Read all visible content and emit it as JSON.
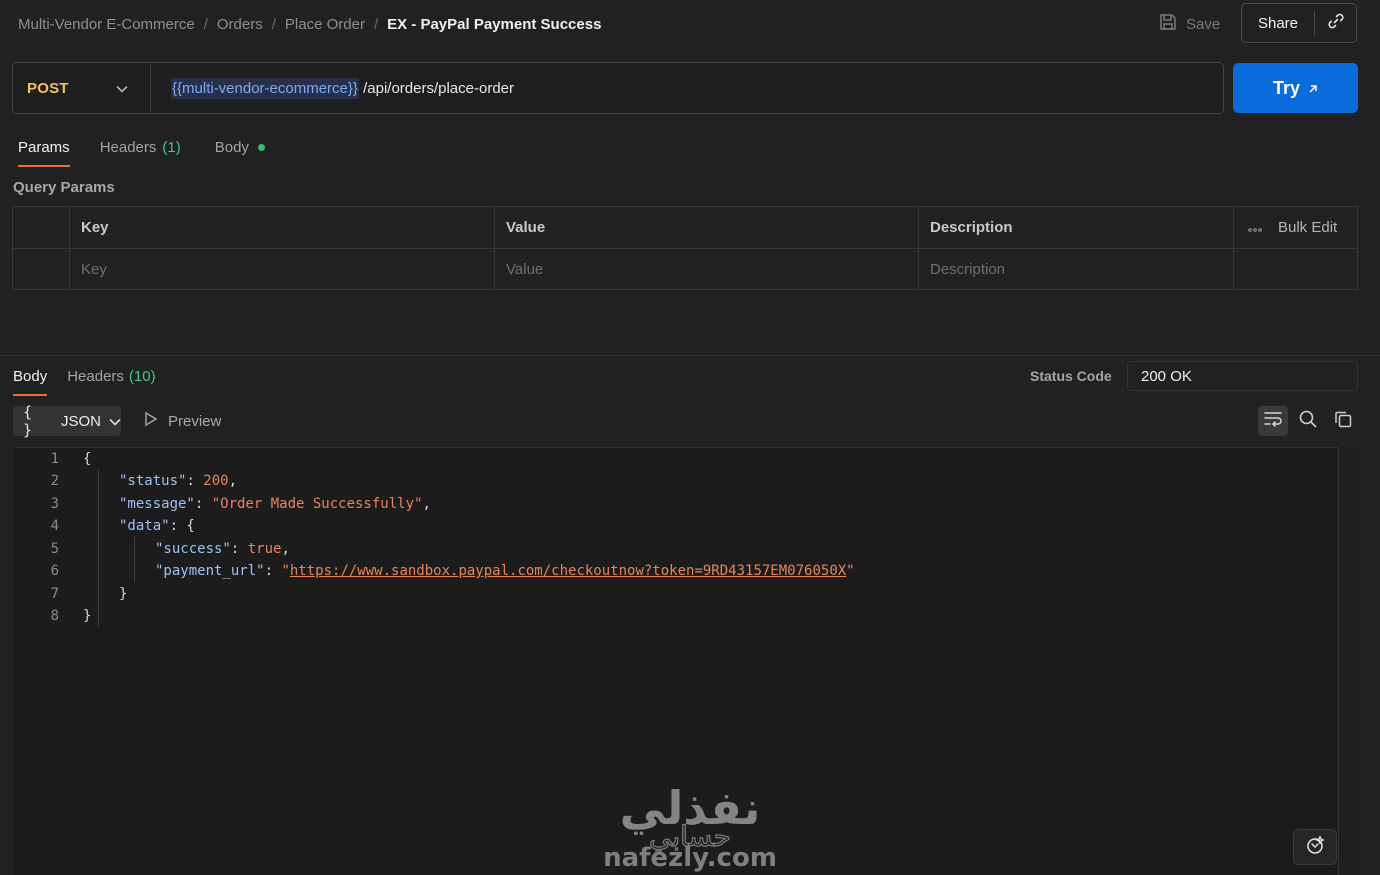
{
  "breadcrumb": {
    "items": [
      "Multi-Vendor E-Commerce",
      "Orders",
      "Place Order"
    ],
    "separator": "/",
    "current": "EX - PayPal Payment Success"
  },
  "header": {
    "save_label": "Save",
    "share_label": "Share"
  },
  "request": {
    "method": "POST",
    "url_variable": "{{multi-vendor-ecommerce}}",
    "url_path": " /api/orders/place-order",
    "try_label": "Try"
  },
  "request_tabs": {
    "params": "Params",
    "headers": "Headers",
    "headers_count": "(1)",
    "body": "Body"
  },
  "query_params": {
    "title": "Query Params",
    "columns": {
      "key": "Key",
      "value": "Value",
      "description": "Description"
    },
    "bulk_edit": "Bulk Edit",
    "placeholders": {
      "key": "Key",
      "value": "Value",
      "description": "Description"
    }
  },
  "response": {
    "tabs": {
      "body": "Body",
      "headers": "Headers",
      "headers_count": "(10)"
    },
    "status_label": "Status Code",
    "status_value": "200 OK",
    "format": "JSON",
    "preview": "Preview",
    "line_numbers": [
      "1",
      "2",
      "3",
      "4",
      "5",
      "6",
      "7",
      "8"
    ],
    "lines": {
      "l1_open": "{",
      "l2_key": "\"status\"",
      "l2_colon": ": ",
      "l2_value": "200",
      "l2_comma": ",",
      "l3_key": "\"message\"",
      "l3_colon": ": ",
      "l3_value": "\"Order Made Successfully\"",
      "l3_comma": ",",
      "l4_key": "\"data\"",
      "l4_rest": ": {",
      "l5_key": "\"success\"",
      "l5_colon": ": ",
      "l5_value": "true",
      "l5_comma": ",",
      "l6_key": "\"payment_url\"",
      "l6_colon": ": ",
      "l6_quote_open": "\"",
      "l6_url": "https://www.sandbox.paypal.com/checkoutnow?token=9RD43157EM076050X",
      "l6_quote_close": "\"",
      "l7_close": "}",
      "l8_close": "}"
    }
  },
  "icons": {
    "save": "save-icon",
    "link": "link-icon",
    "chevron": "chevron-down-icon",
    "arrow": "arrow-up-right-icon",
    "play": "play-icon",
    "wrap": "wrap-lines-icon",
    "search": "search-icon",
    "copy": "copy-icon",
    "fab": "assistant-icon"
  },
  "colors": {
    "accent_try": "#0a6bda",
    "method": "#f3c25c",
    "active_tab_underline": "#ef6c3c",
    "count": "#4cc38a",
    "json_key": "#9cc3f5",
    "json_value": "#e8845c"
  },
  "watermark": {
    "text_ar": "نفذلي",
    "text_ar_2": "حسابي",
    "text_en": "nafezly.com"
  }
}
